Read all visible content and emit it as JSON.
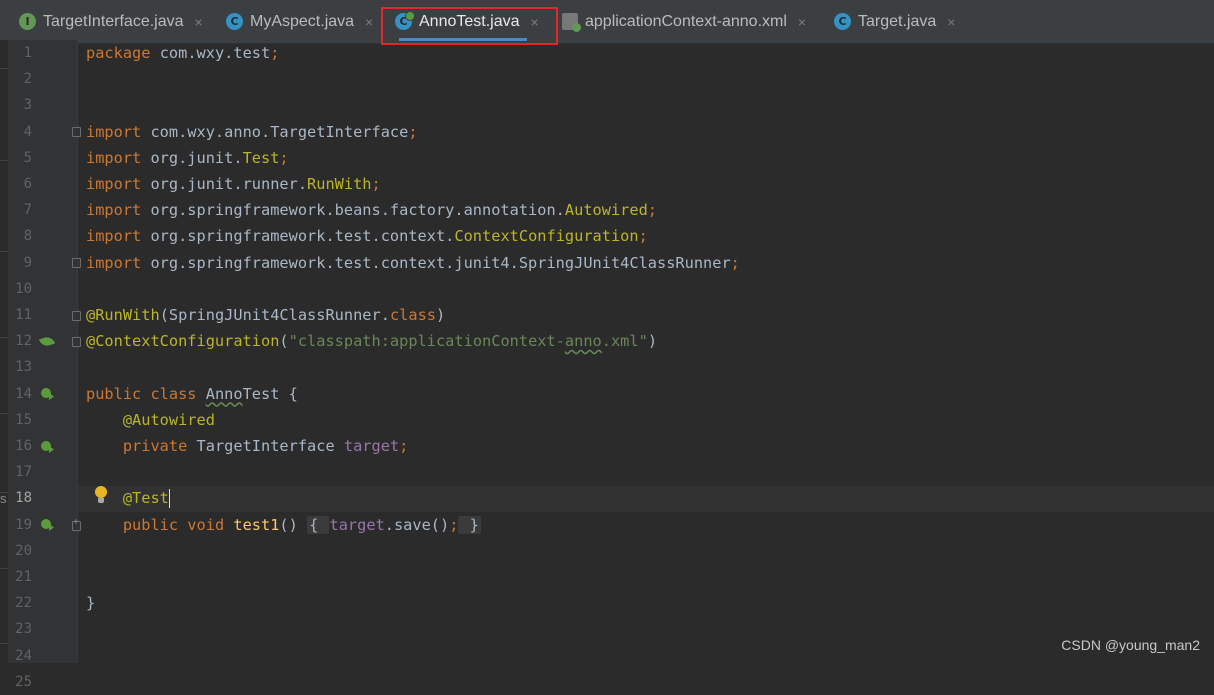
{
  "tabs": [
    {
      "label": "TargetInterface.java",
      "icon": "interface-icon",
      "icon_letter": "I",
      "active": false
    },
    {
      "label": "MyAspect.java",
      "icon": "class-icon",
      "icon_letter": "C",
      "active": false
    },
    {
      "label": "AnnoTest.java",
      "icon": "test-class-icon",
      "icon_letter": "C",
      "active": true
    },
    {
      "label": "applicationContext-anno.xml",
      "icon": "xml-file-icon",
      "icon_letter": "",
      "active": false
    },
    {
      "label": "Target.java",
      "icon": "class-icon",
      "icon_letter": "C",
      "active": false
    }
  ],
  "close_glyph": "×",
  "editor": {
    "current_line": 18,
    "line_numbers": [
      "1",
      "2",
      "3",
      "4",
      "5",
      "6",
      "7",
      "8",
      "9",
      "10",
      "11",
      "12",
      "13",
      "14",
      "15",
      "16",
      "17",
      "18",
      "19",
      "20",
      "21",
      "22",
      "23",
      "24",
      "25"
    ],
    "lines": {
      "l1": {
        "a": "package ",
        "b": "com.wxy.test",
        "c": ";"
      },
      "l4": {
        "a": "import ",
        "b": "com.wxy.anno.TargetInterface",
        "c": ";"
      },
      "l5": {
        "a": "import ",
        "b": "org.junit.",
        "c": "Test",
        "d": ";"
      },
      "l6": {
        "a": "import ",
        "b": "org.junit.runner.",
        "c": "RunWith",
        "d": ";"
      },
      "l7": {
        "a": "import ",
        "b": "org.springframework.beans.factory.annotation.",
        "c": "Autowired",
        "d": ";"
      },
      "l8": {
        "a": "import ",
        "b": "org.springframework.test.context.",
        "c": "ContextConfiguration",
        "d": ";"
      },
      "l9": {
        "a": "import ",
        "b": "org.springframework.test.context.junit4.SpringJUnit4ClassRunner",
        "c": ";"
      },
      "l11": {
        "a": "@RunWith",
        "b": "(SpringJUnit4ClassRunner.",
        "c": "class",
        "d": ")"
      },
      "l12": {
        "a": "@ContextConfiguration",
        "b": "(",
        "c": "\"classpath:applicationContext-",
        "d": "anno",
        "e": ".xml\"",
        "f": ")"
      },
      "l14": {
        "a": "public class ",
        "b": "Anno",
        "c": "Test",
        "d": " {"
      },
      "l15": {
        "a": "    ",
        "b": "@Autowired"
      },
      "l16": {
        "a": "    ",
        "b": "private ",
        "c": "TargetInterface ",
        "d": "target",
        "e": ";"
      },
      "l18": {
        "a": "    ",
        "b": "@Test"
      },
      "l19": {
        "a": "    ",
        "b": "public void ",
        "c": "test1",
        "d": "() ",
        "e": "{ ",
        "f": "target",
        "g": ".save()",
        "h": ";",
        "i": " }"
      },
      "l24": {
        "a": "}"
      }
    }
  },
  "watermark": "CSDN @young_man2",
  "side_mark": "s"
}
